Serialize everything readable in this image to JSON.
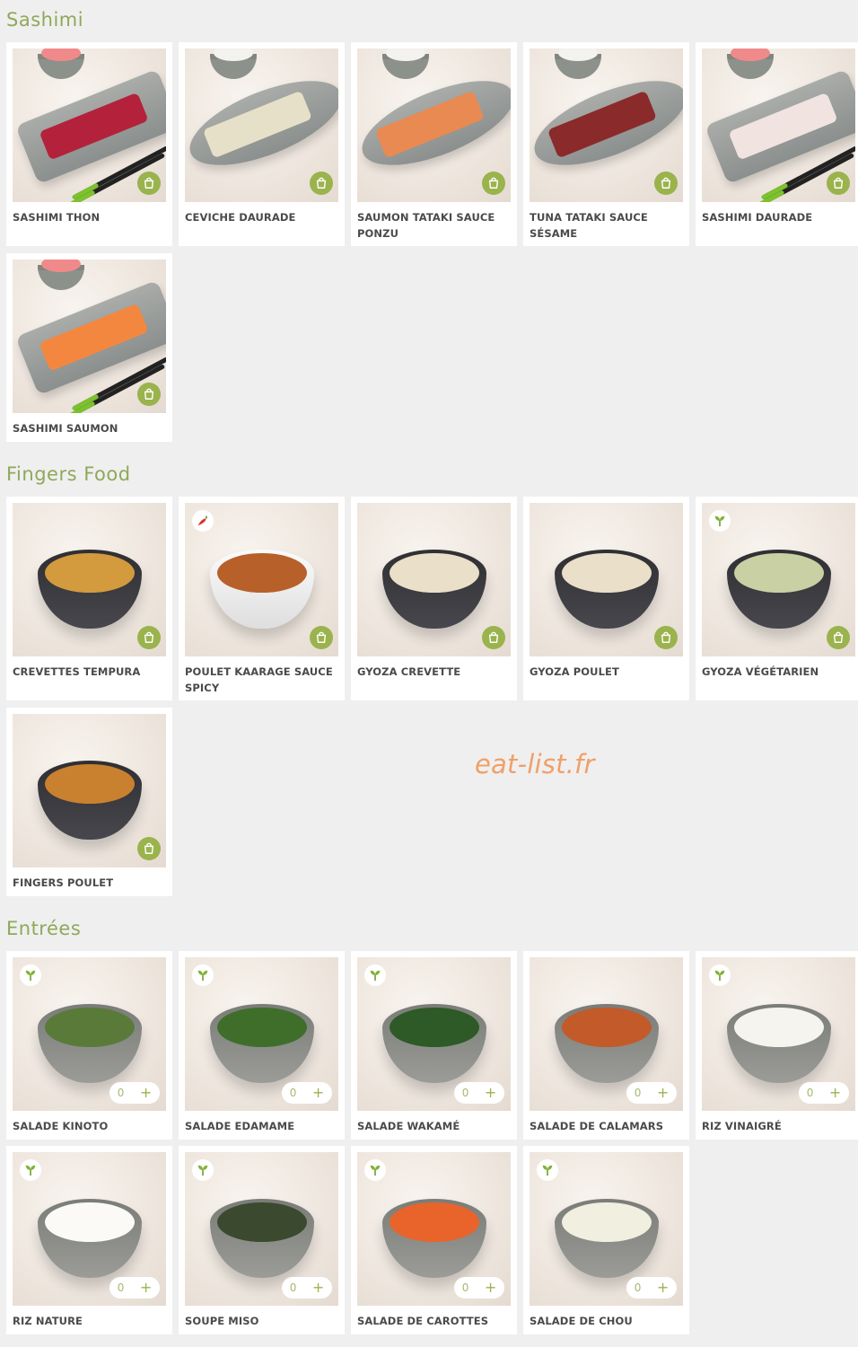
{
  "sections": [
    {
      "title": "Sashimi",
      "items": [
        {
          "name": "SASHIMI THON",
          "kind": "plate",
          "plate_color": "rect",
          "food_color": "#b3223a",
          "side": "ginger",
          "chopsticks": true,
          "badge": "bag-icon"
        },
        {
          "name": "CEVICHE DAURADE",
          "kind": "plate",
          "plate_color": "oval",
          "food_color": "#e6e0c8",
          "side": "rice",
          "chopsticks": false,
          "badge": "bag-icon"
        },
        {
          "name": "SAUMON TATAKI SAUCE PONZU",
          "kind": "plate",
          "plate_color": "oval",
          "food_color": "#e98a52",
          "side": "rice",
          "chopsticks": false,
          "badge": "bag-icon"
        },
        {
          "name": "TUNA TATAKI SAUCE SÉSAME",
          "kind": "plate",
          "plate_color": "oval",
          "food_color": "#8b2a2a",
          "side": "rice",
          "chopsticks": false,
          "badge": "bag-icon"
        },
        {
          "name": "SASHIMI DAURADE",
          "kind": "plate",
          "plate_color": "rect",
          "food_color": "#f1e3e0",
          "side": "ginger",
          "chopsticks": true,
          "badge": "bag-icon"
        },
        {
          "name": "SASHIMI SAUMON",
          "kind": "plate",
          "plate_color": "rect",
          "food_color": "#f4873f",
          "side": "ginger",
          "chopsticks": true,
          "badge": "bag-icon"
        }
      ]
    },
    {
      "title": "Fingers Food",
      "items": [
        {
          "name": "CREVETTES TEMPURA",
          "kind": "bowl",
          "bowl_color": "dark",
          "food_color": "#d39a3e",
          "badge": "bag-icon"
        },
        {
          "name": "POULET KAARAGE SAUCE SPICY",
          "kind": "bowl",
          "bowl_color": "white",
          "food_color": "#b7602a",
          "badge": "bag-icon",
          "tag": "chili-icon"
        },
        {
          "name": "GYOZA CREVETTE",
          "kind": "bowl",
          "bowl_color": "dark",
          "food_color": "#eadfc8",
          "badge": "bag-icon"
        },
        {
          "name": "GYOZA POULET",
          "kind": "bowl",
          "bowl_color": "dark",
          "food_color": "#eadfc8",
          "badge": "bag-icon"
        },
        {
          "name": "GYOZA VÉGÉTARIEN",
          "kind": "bowl",
          "bowl_color": "dark",
          "food_color": "#c9d0a4",
          "badge": "bag-icon",
          "tag": "leaf-icon"
        },
        {
          "name": "FINGERS POULET",
          "kind": "bowl",
          "bowl_color": "dark",
          "food_color": "#c9812f",
          "badge": "bag-icon"
        }
      ]
    },
    {
      "title": "Entrées",
      "items": [
        {
          "name": "SALADE KINOTO",
          "kind": "bowl",
          "bowl_color": "grey",
          "food_color": "#5a7a3a",
          "qty": "0",
          "tag": "leaf-icon"
        },
        {
          "name": "SALADE EDAMAME",
          "kind": "bowl",
          "bowl_color": "grey",
          "food_color": "#3f6e2a",
          "qty": "0",
          "tag": "leaf-icon"
        },
        {
          "name": "SALADE WAKAMÉ",
          "kind": "bowl",
          "bowl_color": "grey",
          "food_color": "#2d5a26",
          "qty": "0",
          "tag": "leaf-icon"
        },
        {
          "name": "SALADE DE CALAMARS",
          "kind": "bowl",
          "bowl_color": "grey",
          "food_color": "#c25a2a",
          "qty": "0"
        },
        {
          "name": "RIZ VINAIGRÉ",
          "kind": "bowl",
          "bowl_color": "grey",
          "food_color": "#f6f4ef",
          "qty": "0",
          "tag": "leaf-icon"
        },
        {
          "name": "RIZ NATURE",
          "kind": "bowl",
          "bowl_color": "grey",
          "food_color": "#fbfaf7",
          "qty": "0",
          "tag": "leaf-icon"
        },
        {
          "name": "SOUPE MISO",
          "kind": "bowl",
          "bowl_color": "grey",
          "food_color": "#3b4a2e",
          "qty": "0",
          "tag": "leaf-icon"
        },
        {
          "name": "SALADE DE CAROTTES",
          "kind": "bowl",
          "bowl_color": "grey",
          "food_color": "#e8642a",
          "qty": "0",
          "tag": "leaf-icon"
        },
        {
          "name": "SALADE DE CHOU",
          "kind": "bowl",
          "bowl_color": "grey",
          "food_color": "#f1efe0",
          "qty": "0",
          "tag": "leaf-icon"
        }
      ]
    }
  ],
  "qty_plus": "+",
  "watermark": "eat-list.fr",
  "colors": {
    "accent": "#9ab34d",
    "section_title": "#8fa85a",
    "background": "#efefef",
    "watermark": "#f0a068"
  }
}
